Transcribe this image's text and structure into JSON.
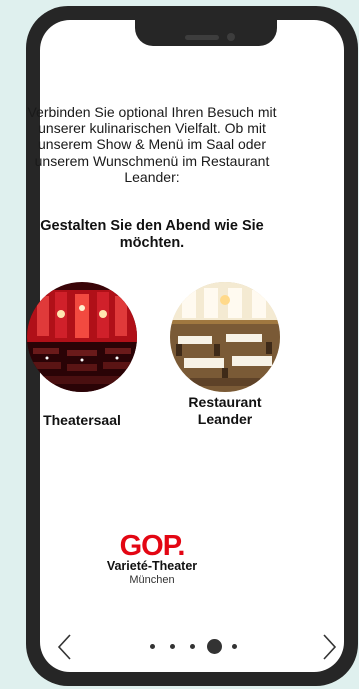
{
  "intro_text": "Verbinden Sie optional Ihren Besuch mit unserer kulinarischen Vielfalt. Ob mit unserem Show & Menü im Saal oder unserem Wunschmenü im Restaurant Leander:",
  "prompt_text": "Gestalten Sie den Abend wie Sie möchten.",
  "options": [
    {
      "label": "Theatersaal",
      "image": "theater-hall-photo"
    },
    {
      "label": "Restaurant Leander",
      "image": "restaurant-photo"
    }
  ],
  "logo": {
    "mark": "GOP.",
    "name": "Varieté-Theater",
    "city": "München",
    "brand_color": "#e30613"
  },
  "navigation": {
    "prev_icon": "chevron-left-icon",
    "next_icon": "chevron-right-icon",
    "page_count": 5,
    "active_page": 4
  },
  "colors": {
    "background": "#dff0ee",
    "device_frame": "#262626",
    "screen": "#ffffff"
  }
}
